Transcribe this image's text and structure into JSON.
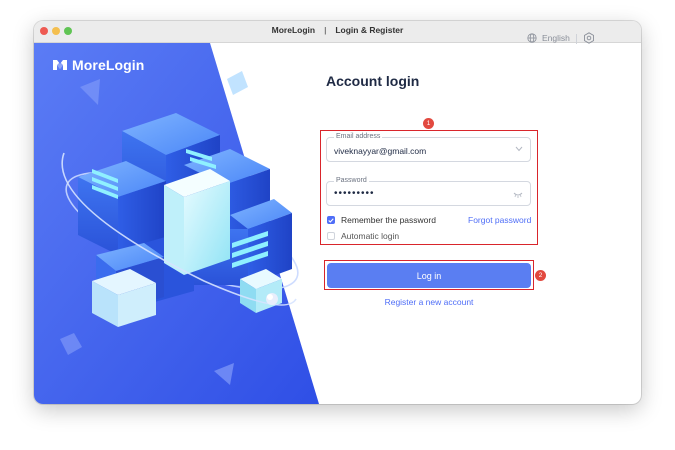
{
  "window": {
    "app_name": "MoreLogin",
    "separator": "|",
    "section": "Login & Register"
  },
  "brand": {
    "logo_text": "MoreLogin"
  },
  "header": {
    "language": "English",
    "globe_icon": "globe-icon",
    "settings_icon": "gear-icon"
  },
  "login": {
    "heading": "Account login",
    "email_label": "Email address",
    "email_value": "viveknayyar@gmail.com",
    "password_label": "Password",
    "password_value": "•••••••••",
    "remember_label": "Remember the password",
    "remember_checked": true,
    "forgot_label": "Forgot password",
    "auto_login_label": "Automatic login",
    "auto_login_checked": false,
    "login_button": "Log in",
    "register_link": "Register a new account"
  },
  "annotations": {
    "badge_1": "1",
    "badge_2": "2",
    "highlight_color": "#d9252b"
  },
  "colors": {
    "accent": "#4f6ef7",
    "button": "#5a7ef2",
    "hero_blue": "#3b5cf0"
  }
}
